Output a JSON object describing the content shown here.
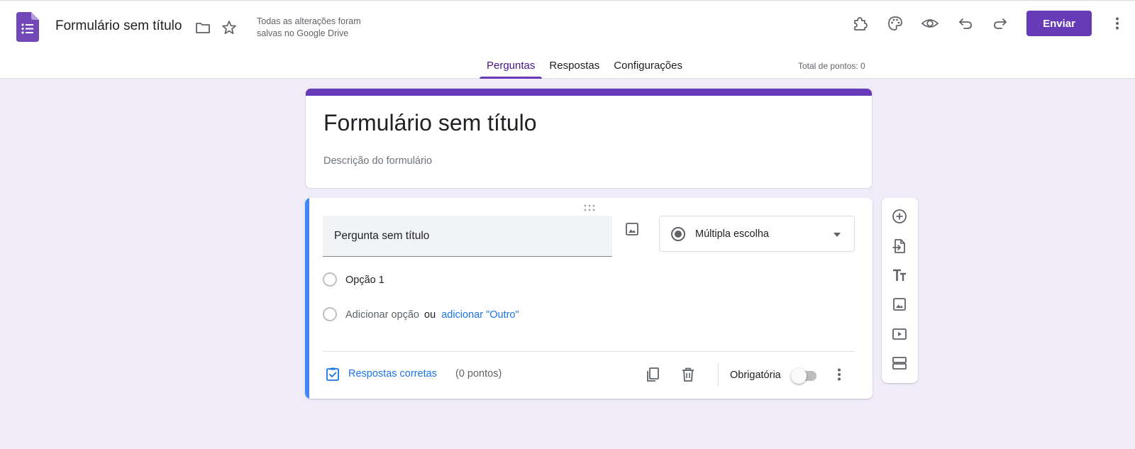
{
  "header": {
    "doc_title": "Formulário sem título",
    "save_status": "Todas as alterações foram salvas no Google Drive",
    "send_label": "Enviar",
    "icons": [
      "forms-logo-icon",
      "folder-icon",
      "star-icon",
      "addons-puzzle-icon",
      "palette-icon",
      "preview-eye-icon",
      "undo-icon",
      "redo-icon",
      "more-vert-icon"
    ]
  },
  "tabs": [
    {
      "label": "Perguntas",
      "active": true
    },
    {
      "label": "Respostas",
      "active": false
    },
    {
      "label": "Configurações",
      "active": false
    }
  ],
  "points_total": "Total de pontos: 0",
  "form": {
    "title": "Formulário sem título",
    "description_placeholder": "Descrição do formulário"
  },
  "question": {
    "title": "Pergunta sem título",
    "type": "Múltipla escolha",
    "options": [
      "Opção 1"
    ],
    "add_option": "Adicionar opção",
    "or": "ou",
    "add_other": "adicionar \"Outro\"",
    "answer_key": "Respostas corretas",
    "points": "(0 pontos)",
    "required_label": "Obrigatória",
    "required": false
  },
  "side_toolbar": [
    "add-question-icon",
    "import-questions-icon",
    "add-title-icon",
    "add-image-icon",
    "add-video-icon",
    "add-section-icon"
  ],
  "colors": {
    "accent": "#673ab7",
    "background": "#f0ebf8",
    "link": "#1a73e8",
    "question_bar": "#4285f4"
  }
}
